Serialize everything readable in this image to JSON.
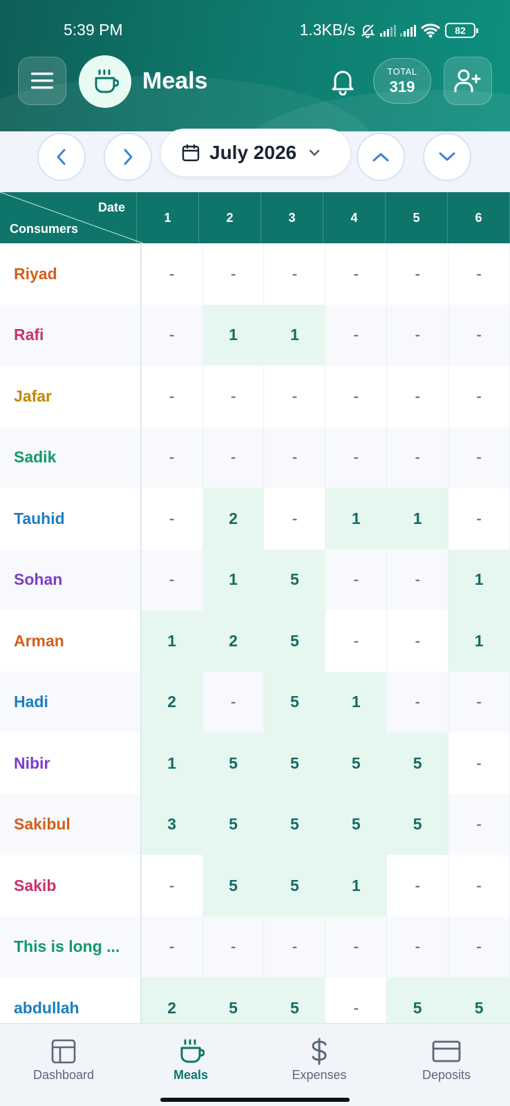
{
  "status_bar": {
    "time": "5:39 PM",
    "network_speed": "1.3KB/s",
    "battery": "82"
  },
  "header": {
    "title": "Meals",
    "total_label": "TOTAL",
    "total_value": "319",
    "icons": [
      "menu-icon",
      "coffee-cup-icon",
      "bell-icon",
      "add-user-icon"
    ]
  },
  "toolbar": {
    "month": "July 2026",
    "icons": [
      "chevron-left-icon",
      "chevron-right-icon",
      "calendar-icon",
      "chevron-down-icon",
      "chevron-up-icon",
      "chevron-down-icon"
    ]
  },
  "grid": {
    "date_label": "Date",
    "consumers_label": "Consumers",
    "dates": [
      "1",
      "2",
      "3",
      "4",
      "5",
      "6"
    ],
    "rows": [
      {
        "name": "Riyad",
        "color": "#d35f1b",
        "values": [
          "-",
          "-",
          "-",
          "-",
          "-",
          "-"
        ]
      },
      {
        "name": "Rafi",
        "color": "#cc2f6e",
        "values": [
          "-",
          "1",
          "1",
          "-",
          "-",
          "-"
        ]
      },
      {
        "name": "Jafar",
        "color": "#c08a00",
        "values": [
          "-",
          "-",
          "-",
          "-",
          "-",
          "-"
        ]
      },
      {
        "name": "Sadik",
        "color": "#129869",
        "values": [
          "-",
          "-",
          "-",
          "-",
          "-",
          "-"
        ]
      },
      {
        "name": "Tauhid",
        "color": "#1a7fc1",
        "values": [
          "-",
          "2",
          "-",
          "1",
          "1",
          "-"
        ]
      },
      {
        "name": "Sohan",
        "color": "#7d3cc9",
        "values": [
          "-",
          "1",
          "5",
          "-",
          "-",
          "1"
        ]
      },
      {
        "name": "Arman",
        "color": "#d35f1b",
        "values": [
          "1",
          "2",
          "5",
          "-",
          "-",
          "1"
        ]
      },
      {
        "name": "Hadi",
        "color": "#1a7fc1",
        "values": [
          "2",
          "-",
          "5",
          "1",
          "-",
          "-"
        ]
      },
      {
        "name": "Nibir",
        "color": "#7d3cc9",
        "values": [
          "1",
          "5",
          "5",
          "5",
          "5",
          "-"
        ]
      },
      {
        "name": "Sakibul",
        "color": "#d35f1b",
        "values": [
          "3",
          "5",
          "5",
          "5",
          "5",
          "-"
        ]
      },
      {
        "name": "Sakib",
        "color": "#cc2f6e",
        "values": [
          "-",
          "5",
          "5",
          "1",
          "-",
          "-"
        ]
      },
      {
        "name": "This is long ...",
        "color": "#129869",
        "values": [
          "-",
          "-",
          "-",
          "-",
          "-",
          "-"
        ]
      },
      {
        "name": "abdullah",
        "color": "#1a7fc1",
        "values": [
          "2",
          "5",
          "5",
          "-",
          "5",
          "5"
        ]
      }
    ]
  },
  "bottom_nav": {
    "items": [
      {
        "label": "Dashboard",
        "icon": "layout-icon",
        "active": false
      },
      {
        "label": "Meals",
        "icon": "coffee-cup-icon",
        "active": true
      },
      {
        "label": "Expenses",
        "icon": "dollar-icon",
        "active": false
      },
      {
        "label": "Deposits",
        "icon": "credit-card-icon",
        "active": false
      }
    ]
  },
  "colors": {
    "header": "#0f756b",
    "accent": "#0f756b",
    "cell_highlight": "#e6f7ef",
    "nav_button_border": "#d4e3f7"
  }
}
